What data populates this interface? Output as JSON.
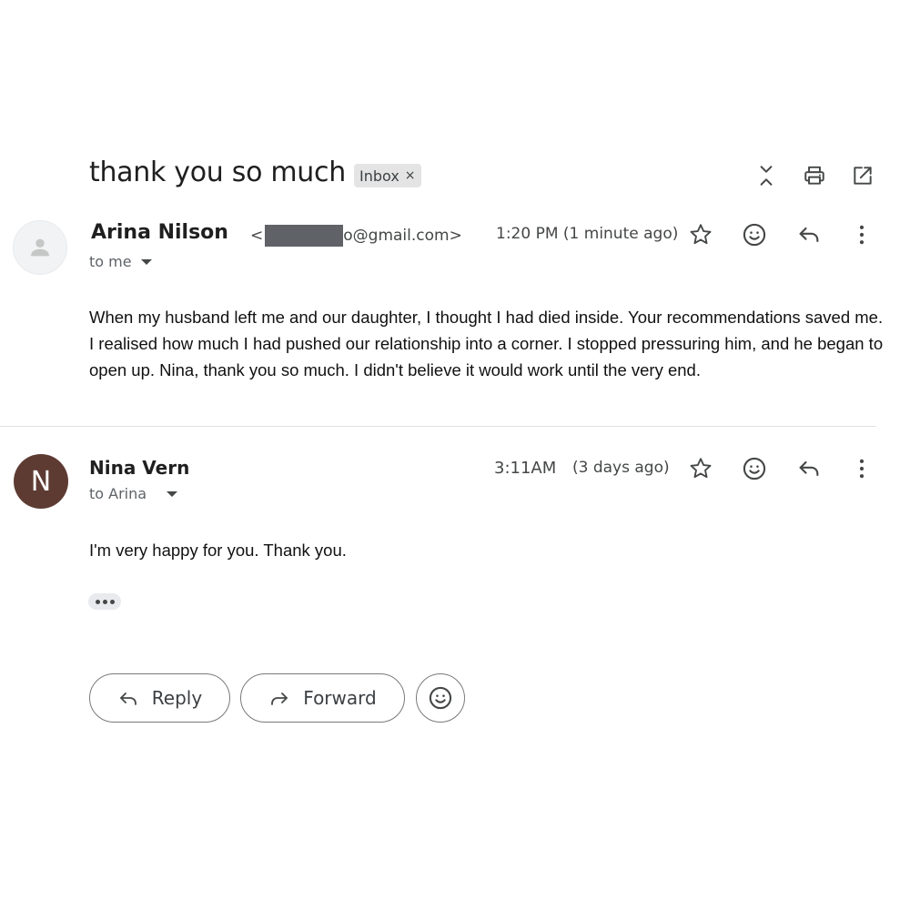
{
  "thread": {
    "subject": "thank you so much",
    "label": "Inbox",
    "label_remove": "×"
  },
  "toolbar_icons": [
    "collapse-all-icon",
    "print-icon",
    "open-in-new-window-icon"
  ],
  "messages": [
    {
      "avatar_letter": "",
      "sender_name": "Arina Nilson",
      "sender_email_prefix": "<",
      "sender_email_suffix": "o@gmail.com>",
      "recipient": "to me",
      "time": "1:20 PM (1 minute ago)",
      "body": "When my husband left me and our daughter, I thought I had died inside. Your recommendations saved me. I realised how much I had pushed our relationship into a corner. I stopped pressuring him, and he began to open up. Nina, thank you so much. I didn't believe it would work until the very end."
    },
    {
      "avatar_letter": "N",
      "avatar_color": "#5d3b33",
      "sender_name": "Nina Vern",
      "recipient": "to Arina",
      "time": "3:11AM",
      "time_relative": "(3 days ago)",
      "body": "I'm very happy for you. Thank you."
    }
  ],
  "message_actions": [
    "star-icon",
    "emoji-reaction-icon",
    "reply-icon",
    "more-options-icon"
  ],
  "footer": {
    "reply_label": "Reply",
    "forward_label": "Forward"
  }
}
